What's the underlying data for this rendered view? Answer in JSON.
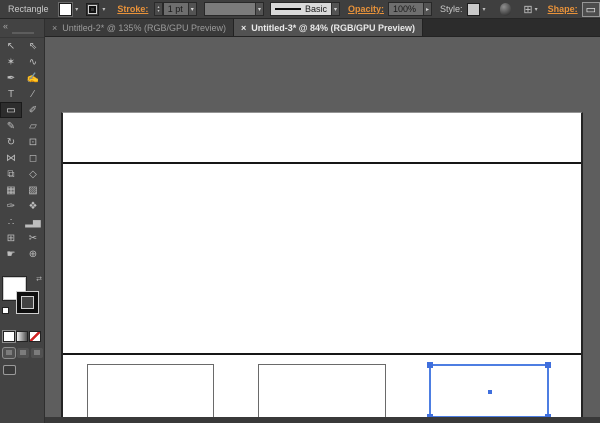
{
  "control_bar": {
    "tool_name": "Rectangle",
    "stroke_label": "Stroke:",
    "stroke_weight_value": "1 pt",
    "brush_name": "Basic",
    "opacity_label": "Opacity:",
    "opacity_value": "100%",
    "style_label": "Style:",
    "shape_label": "Shape:",
    "accent_link_color": "#e8923a",
    "fill_color": "#ffffff",
    "stroke_color": "#000000"
  },
  "icons": {
    "dropdown_arrow": "▾",
    "dropdown_arrow_right": "▸",
    "spinner_up": "▴",
    "spinner_down": "▾",
    "collapse": "«",
    "swap": "⇄",
    "align_grid": "⊞",
    "shape_widget": "▭"
  },
  "tab_bar": {
    "tabs": [
      {
        "close": "×",
        "label": "Untitled-2* @ 135% (RGB/GPU Preview)",
        "active": false
      },
      {
        "close": "×",
        "label": "Untitled-3* @ 84% (RGB/GPU Preview)",
        "active": true
      }
    ]
  },
  "toolbar": {
    "tools": [
      {
        "name": "selection",
        "glyph": "↖",
        "active": false
      },
      {
        "name": "direct-selection",
        "glyph": "⇖",
        "active": false
      },
      {
        "name": "magic-wand",
        "glyph": "✶",
        "active": false
      },
      {
        "name": "lasso",
        "glyph": "∿",
        "active": false
      },
      {
        "name": "pen",
        "glyph": "✒",
        "active": false
      },
      {
        "name": "curvature",
        "glyph": "✍",
        "active": false
      },
      {
        "name": "type",
        "glyph": "T",
        "active": false
      },
      {
        "name": "line-segment",
        "glyph": "∕",
        "active": false
      },
      {
        "name": "rectangle",
        "glyph": "▭",
        "active": true
      },
      {
        "name": "paintbrush",
        "glyph": "✐",
        "active": false
      },
      {
        "name": "shaper",
        "glyph": "✎",
        "active": false
      },
      {
        "name": "eraser",
        "glyph": "▱",
        "active": false
      },
      {
        "name": "rotate",
        "glyph": "↻",
        "active": false
      },
      {
        "name": "scale",
        "glyph": "⊡",
        "active": false
      },
      {
        "name": "width",
        "glyph": "⋈",
        "active": false
      },
      {
        "name": "free-transform",
        "glyph": "◻",
        "active": false
      },
      {
        "name": "shape-builder",
        "glyph": "⧉",
        "active": false
      },
      {
        "name": "perspective-grid",
        "glyph": "◇",
        "active": false
      },
      {
        "name": "mesh",
        "glyph": "▦",
        "active": false
      },
      {
        "name": "gradient",
        "glyph": "▨",
        "active": false
      },
      {
        "name": "eyedropper",
        "glyph": "✑",
        "active": false
      },
      {
        "name": "blend",
        "glyph": "❖",
        "active": false
      },
      {
        "name": "symbol-sprayer",
        "glyph": "∴",
        "active": false
      },
      {
        "name": "column-graph",
        "glyph": "▂▅",
        "active": false
      },
      {
        "name": "artboard",
        "glyph": "⊞",
        "active": false
      },
      {
        "name": "slice",
        "glyph": "✂",
        "active": false
      },
      {
        "name": "hand",
        "glyph": "☛",
        "active": false
      },
      {
        "name": "zoom",
        "glyph": "⊕",
        "active": false
      }
    ]
  },
  "canvas": {
    "artboard_color": "#ffffff",
    "pasteboard_color": "#5e5e5e",
    "selection_color": "#4d7ee2",
    "objects_note": "top band rectangle, large middle rectangle, three small rectangles along bottom, rightmost selected"
  }
}
